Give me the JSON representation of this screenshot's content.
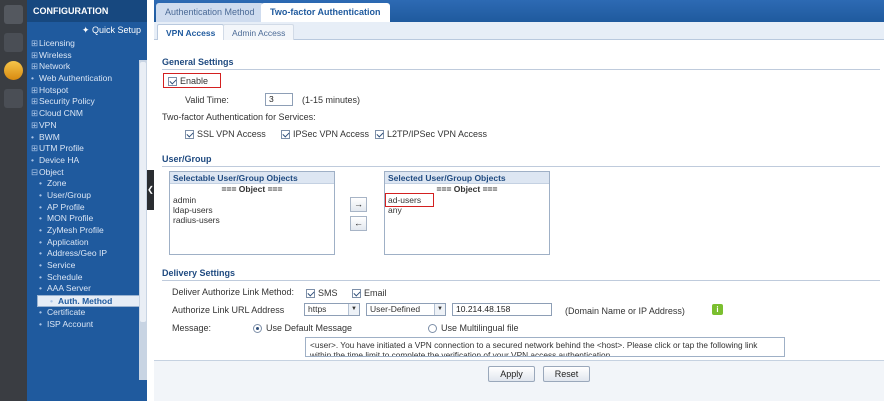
{
  "sidebar": {
    "header": "CONFIGURATION",
    "quick_setup": "Quick Setup",
    "items": [
      {
        "label": "Licensing",
        "type": "group"
      },
      {
        "label": "Wireless",
        "type": "group"
      },
      {
        "label": "Network",
        "type": "group"
      },
      {
        "label": "Web Authentication",
        "type": "leaf"
      },
      {
        "label": "Hotspot",
        "type": "group"
      },
      {
        "label": "Security Policy",
        "type": "group"
      },
      {
        "label": "Cloud CNM",
        "type": "group"
      },
      {
        "label": "VPN",
        "type": "group"
      },
      {
        "label": "BWM",
        "type": "leaf"
      },
      {
        "label": "UTM Profile",
        "type": "group"
      },
      {
        "label": "Device HA",
        "type": "leaf"
      },
      {
        "label": "Object",
        "type": "open"
      }
    ],
    "sub_items": [
      "Zone",
      "User/Group",
      "AP Profile",
      "MON Profile",
      "ZyMesh Profile",
      "Application",
      "Address/Geo IP",
      "Service",
      "Schedule",
      "AAA Server",
      "Auth. Method",
      "Certificate",
      "ISP Account"
    ],
    "active_sub": "Auth. Method"
  },
  "tabs": {
    "top": [
      "Authentication Method",
      "Two-factor Authentication"
    ],
    "sub": [
      "VPN Access",
      "Admin Access"
    ]
  },
  "general": {
    "title": "General Settings",
    "enable_label": "Enable",
    "valid_time_label": "Valid Time:",
    "valid_time_value": "3",
    "valid_time_hint": "(1-15 minutes)",
    "services_label": "Two-factor Authentication for Services:",
    "services": [
      "SSL VPN Access",
      "IPSec VPN Access",
      "L2TP/IPSec VPN Access"
    ]
  },
  "usergroup": {
    "title": "User/Group",
    "selectable_header": "Selectable User/Group Objects",
    "selected_header": "Selected User/Group Objects",
    "object_divider": "=== Object ===",
    "selectable": [
      "admin",
      "ldap-users",
      "radius-users"
    ],
    "selected": [
      "ad-users",
      "any"
    ],
    "move_right": "→",
    "move_left": "←"
  },
  "delivery": {
    "title": "Delivery Settings",
    "method_label": "Deliver Authorize Link Method:",
    "sms_label": "SMS",
    "email_label": "Email",
    "url_label": "Authorize Link URL Address",
    "protocol": "https",
    "host_type": "User-Defined",
    "host_value": "10.214.48.158",
    "host_hint": "(Domain Name or IP Address)",
    "message_label": "Message:",
    "default_msg_label": "Use Default Message",
    "multilingual_label": "Use Multilingual file",
    "message_text": "<user>. You have initiated a VPN connection to a secured network behind the <host>. Please click or tap the following link within the time limit to complete the verification of your VPN access authentication."
  },
  "footer": {
    "apply": "Apply",
    "reset": "Reset"
  }
}
